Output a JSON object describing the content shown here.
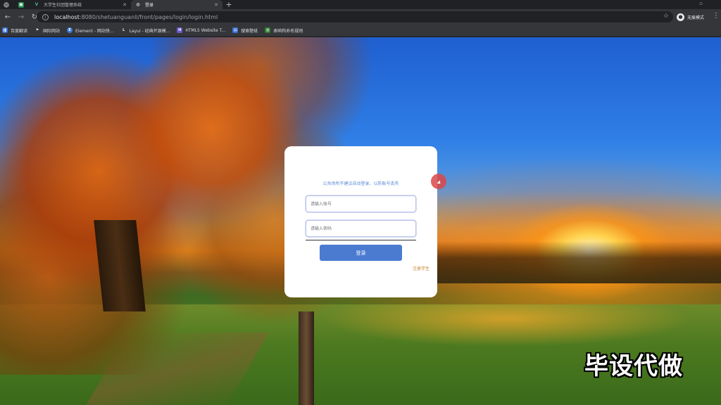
{
  "browser": {
    "tabs": [
      {
        "title": "大学生社团管理系统",
        "favicon": "vue-v-icon",
        "active": false
      },
      {
        "title": "登录",
        "favicon": "globe-icon",
        "active": true
      }
    ],
    "new_tab": "+",
    "close_glyph": "✕",
    "address": {
      "host": "localhost",
      "path": ":8080/shetuanguanli/front/pages/login/login.html"
    },
    "profile_label": "无痕模式",
    "bookmarks": [
      {
        "label": "百度翻译",
        "color": "#3b6fd6"
      },
      {
        "label": "国际网站",
        "color": "#555"
      },
      {
        "label": "Element - 网站快...",
        "color": "#3a7bd5"
      },
      {
        "label": "Layui - 经典开源模...",
        "color": "#2d2d2d"
      },
      {
        "label": "HTML5 Website T...",
        "color": "#6a5acd"
      },
      {
        "label": "搜索壁纸",
        "color": "#3b6fd6"
      },
      {
        "label": "表响构命名规则",
        "color": "#2e7d32"
      }
    ]
  },
  "login": {
    "tip": "公共场所不建议自动登录，以防账号丢失",
    "username_placeholder": "请输入账号",
    "password_placeholder": "请输入密码",
    "login_button": "登录",
    "register_link": "注册学生",
    "colors": {
      "button": "#4a7bd0",
      "tip": "#5b8bd6",
      "link": "#c9842c"
    }
  },
  "watermark": "毕设代做"
}
